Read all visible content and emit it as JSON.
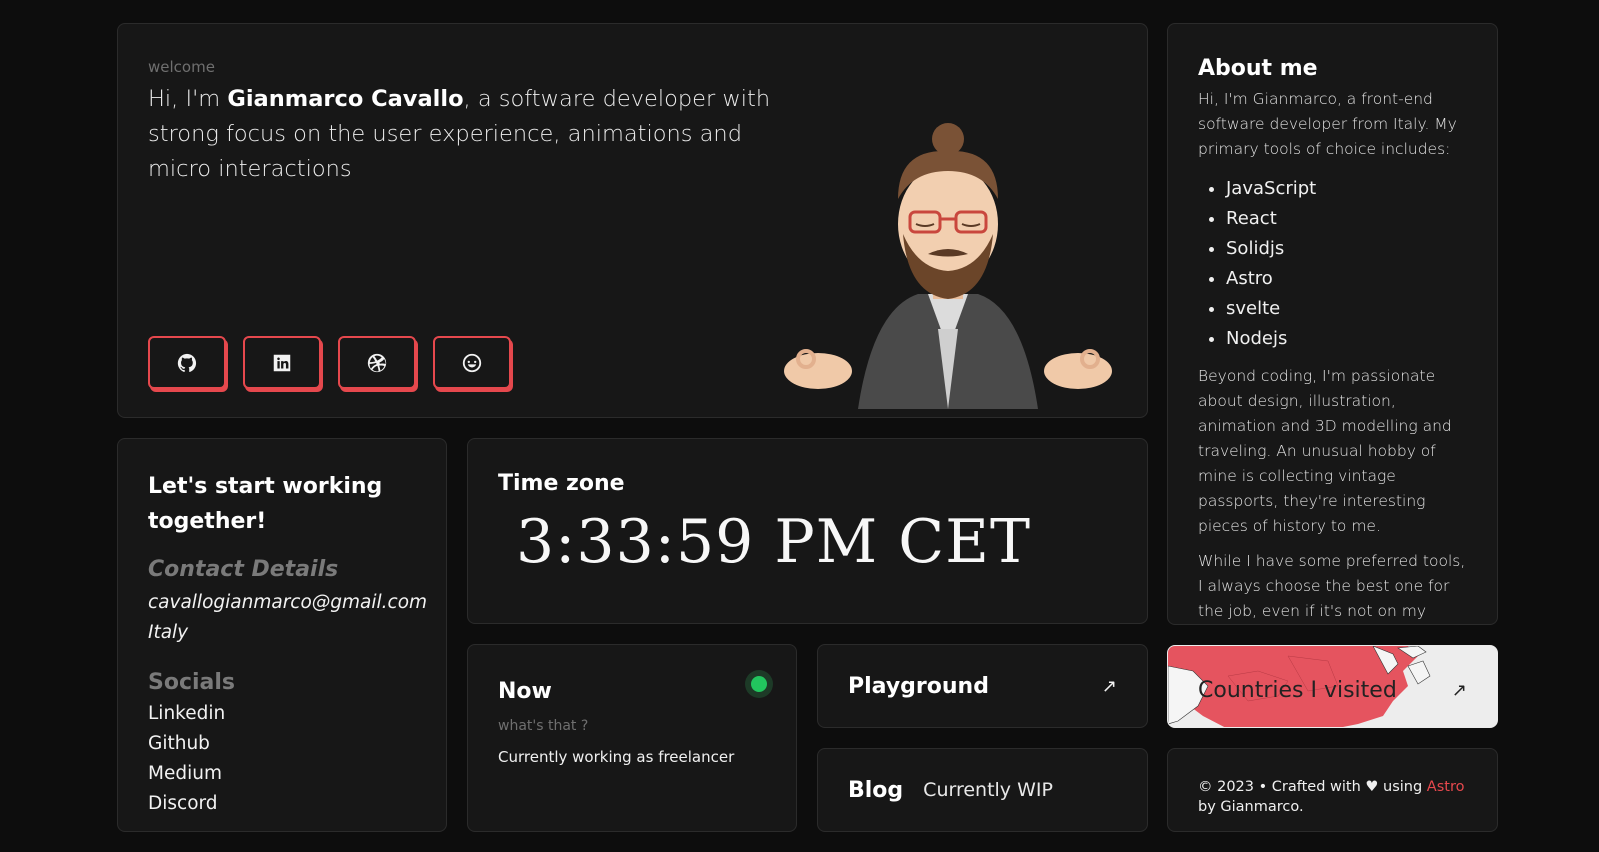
{
  "hero": {
    "welcome": "welcome",
    "intro_prefix": "Hi, I'm ",
    "name": "Gianmarco Cavallo",
    "intro_suffix": ", a software developer with strong focus on the user experience, animations and micro interactions",
    "socials": [
      {
        "icon": "github-icon"
      },
      {
        "icon": "linkedin-icon"
      },
      {
        "icon": "dribbble-icon"
      },
      {
        "icon": "reddit-icon"
      }
    ],
    "accent_color": "#e5484d"
  },
  "about": {
    "title": "About me",
    "intro": "Hi, I'm Gianmarco, a front-end software developer from Italy. My primary tools of choice includes:",
    "tools": [
      "JavaScript",
      "React",
      "Solidjs",
      "Astro",
      "svelte",
      "Nodejs"
    ],
    "paragraph1": "Beyond coding, I'm passionate about design, illustration, animation and 3D modelling and traveling. An unusual hobby of mine is collecting vintage passports, they're interesting pieces of history to me.",
    "paragraph2": "While I have some preferred tools, I always choose the best one for the job, even if it's not on my usual list."
  },
  "contact": {
    "title": "Let's start working together!",
    "details_title": "Contact Details",
    "email": "cavallogianmarco@gmail.com",
    "location": "Italy",
    "socials_title": "Socials",
    "socials": [
      "Linkedin",
      "Github",
      "Medium",
      "Discord"
    ]
  },
  "timezone": {
    "title": "Time zone",
    "time": "3:33:59 PM CET"
  },
  "now": {
    "title": "Now",
    "subtitle": "what's that ?",
    "text": "Currently working as freelancer",
    "status_color": "#22c55e"
  },
  "playground": {
    "title": "Playground",
    "arrow": "↗"
  },
  "blog": {
    "title": "Blog",
    "status": "Currently WIP"
  },
  "countries": {
    "title": "Countries I visited",
    "arrow": "↗",
    "visited_color": "#e5545f"
  },
  "footer": {
    "prefix": "© 2023 • Crafted with ♥ using ",
    "accent": "Astro",
    "suffix": " by Gianmarco."
  }
}
